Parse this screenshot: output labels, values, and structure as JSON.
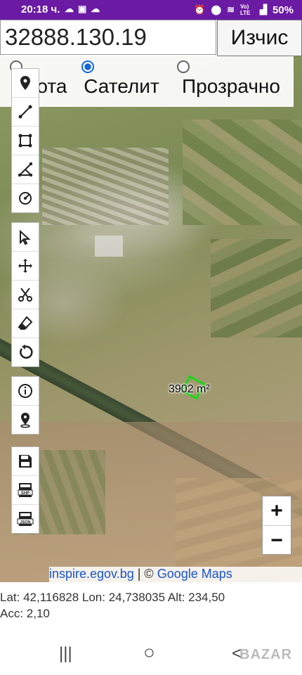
{
  "status_bar": {
    "time": "20:18 ч.",
    "left_icons": [
      "weather-icon",
      "gallery-icon",
      "cloud-icon"
    ],
    "right_icons": [
      "alarm-icon",
      "location-icon",
      "wifi-icon",
      "volte-icon",
      "signal-icon"
    ],
    "volte_text": "Vo) LTE",
    "battery": "50%"
  },
  "search": {
    "value": "32888.130.19",
    "calc_label": "Изчис"
  },
  "map_types": [
    {
      "label": "Нрота",
      "checked": false
    },
    {
      "label": "Сателит",
      "checked": true
    },
    {
      "label": "Прозрачно",
      "checked": false
    }
  ],
  "tools_draw": [
    "marker-icon",
    "line-icon",
    "polygon-icon",
    "measure-icon",
    "circle-icon"
  ],
  "tools_edit": [
    "select-icon",
    "move-icon",
    "cut-icon",
    "eraser-icon",
    "undo-icon"
  ],
  "tools_info": [
    "info-icon",
    "gps-pin-icon"
  ],
  "tools_export": [
    "save-icon",
    "shp-export-icon",
    "json-export-icon"
  ],
  "export_labels": {
    "shp": "SHP",
    "json": "JSON"
  },
  "parcel": {
    "area_label": "3902 m²"
  },
  "zoom": {
    "in_label": "+",
    "out_label": "−"
  },
  "attribution": {
    "source1": "inspire.egov.bg",
    "separator": " | © ",
    "source2": "Google Maps"
  },
  "coords": {
    "line1": "Lat: 42,116828 Lon: 24,738035 Alt: 234,50",
    "line2": "Acc: 2,10"
  },
  "nav": {
    "recents": "|||",
    "home": "○",
    "back": "<"
  },
  "watermark": "BAZAR"
}
